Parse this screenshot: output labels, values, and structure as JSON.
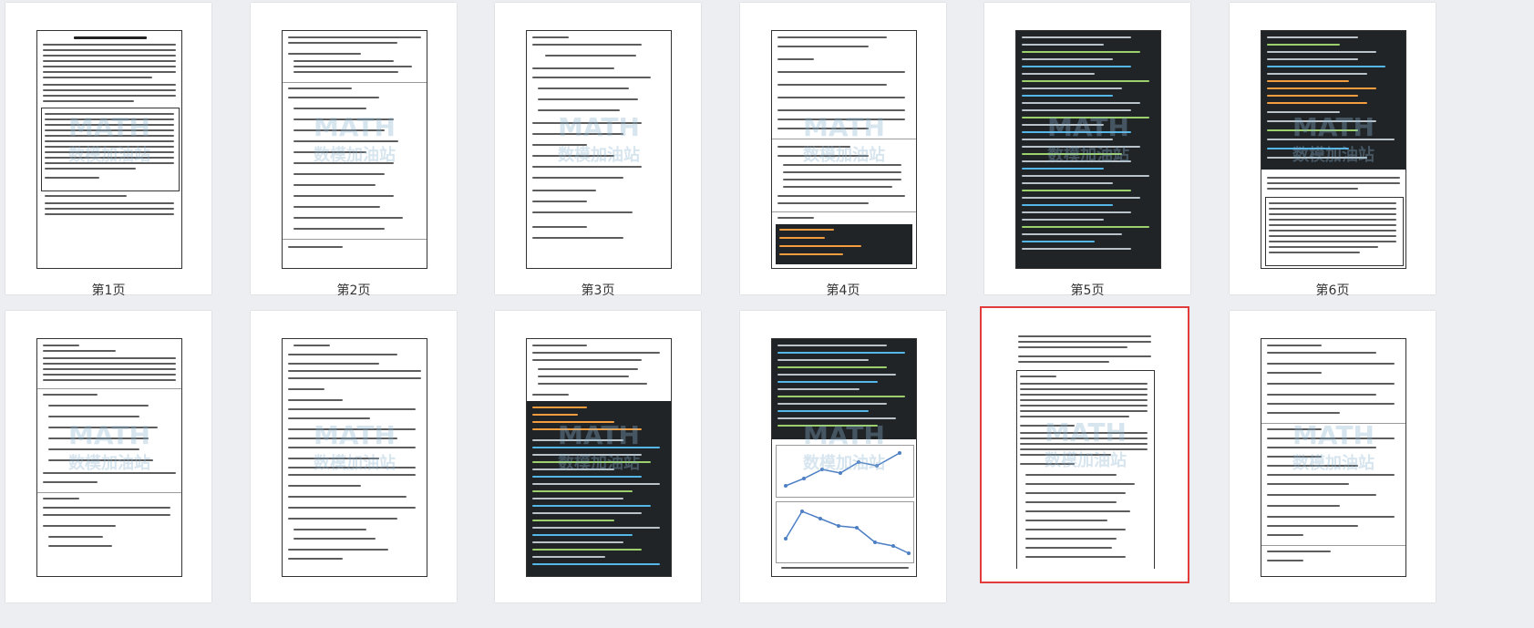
{
  "pages": [
    {
      "label": "第1页",
      "kind": "text",
      "selected": false
    },
    {
      "label": "第2页",
      "kind": "text",
      "selected": false
    },
    {
      "label": "第3页",
      "kind": "text",
      "selected": false
    },
    {
      "label": "第4页",
      "kind": "text",
      "selected": false
    },
    {
      "label": "第5页",
      "kind": "code",
      "selected": false
    },
    {
      "label": "第6页",
      "kind": "code",
      "selected": false
    },
    {
      "label": "",
      "kind": "text",
      "selected": false
    },
    {
      "label": "",
      "kind": "text",
      "selected": false
    },
    {
      "label": "",
      "kind": "code",
      "selected": false
    },
    {
      "label": "",
      "kind": "chart",
      "selected": false
    },
    {
      "label": "",
      "kind": "text",
      "selected": true
    },
    {
      "label": "",
      "kind": "text",
      "selected": false
    }
  ],
  "watermark": {
    "main": "MATH",
    "sub": "数模加油站"
  },
  "colors": {
    "selected": "#e23b3b",
    "code_bg": "#202427"
  }
}
